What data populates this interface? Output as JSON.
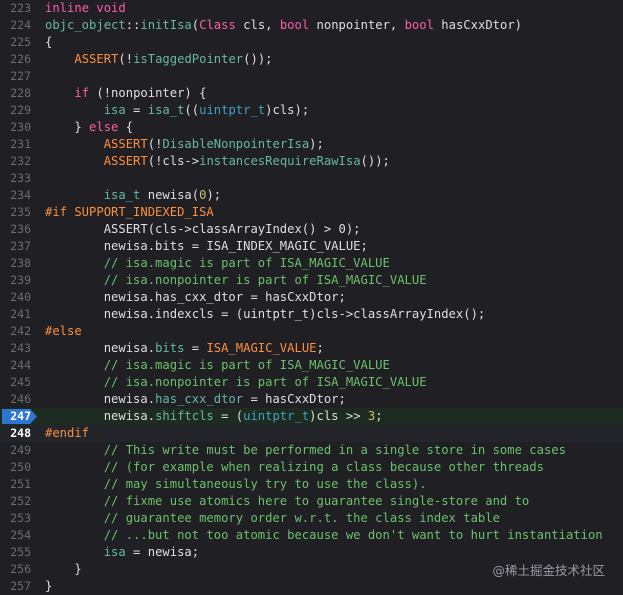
{
  "editor": {
    "lines": [
      {
        "n": "223",
        "code": "inline void",
        "tokens": [
          [
            "kw",
            "inline void"
          ]
        ]
      },
      {
        "n": "224",
        "code": "objc_object::initIsa(Class cls, bool nonpointer, bool hasCxxDtor)",
        "tokens": [
          [
            "fn",
            "objc_object"
          ],
          [
            "",
            "::"
          ],
          [
            "fn",
            "initIsa"
          ],
          [
            "",
            "("
          ],
          [
            "kw",
            "Class"
          ],
          [
            "",
            " cls, "
          ],
          [
            "kw",
            "bool"
          ],
          [
            "",
            " nonpointer, "
          ],
          [
            "kw",
            "bool"
          ],
          [
            "",
            " hasCxxDtor)"
          ]
        ]
      },
      {
        "n": "225",
        "code": "{",
        "tokens": [
          [
            "",
            "{"
          ]
        ]
      },
      {
        "n": "226",
        "code": "    ASSERT(!isTaggedPointer());",
        "tokens": [
          [
            "",
            "    "
          ],
          [
            "mac",
            "ASSERT"
          ],
          [
            "",
            "(!"
          ],
          [
            "fn",
            "isTaggedPointer"
          ],
          [
            "",
            "());"
          ]
        ]
      },
      {
        "n": "227",
        "code": "",
        "tokens": []
      },
      {
        "n": "228",
        "code": "    if (!nonpointer) {",
        "tokens": [
          [
            "",
            "    "
          ],
          [
            "kw",
            "if"
          ],
          [
            "",
            " (!nonpointer) {"
          ]
        ]
      },
      {
        "n": "229",
        "code": "        isa = isa_t((uintptr_t)cls);",
        "tokens": [
          [
            "",
            "        "
          ],
          [
            "fn",
            "isa"
          ],
          [
            "",
            " = "
          ],
          [
            "fn",
            "isa_t"
          ],
          [
            "",
            "(("
          ],
          [
            "ty",
            "uintptr_t"
          ],
          [
            "",
            ")cls);"
          ]
        ]
      },
      {
        "n": "230",
        "code": "    } else {",
        "tokens": [
          [
            "",
            "    } "
          ],
          [
            "kw",
            "else"
          ],
          [
            "",
            " {"
          ]
        ]
      },
      {
        "n": "231",
        "code": "        ASSERT(!DisableNonpointerIsa);",
        "tokens": [
          [
            "",
            "        "
          ],
          [
            "mac",
            "ASSERT"
          ],
          [
            "",
            "(!"
          ],
          [
            "fn",
            "DisableNonpointerIsa"
          ],
          [
            "",
            ");"
          ]
        ]
      },
      {
        "n": "232",
        "code": "        ASSERT(!cls->instancesRequireRawIsa());",
        "tokens": [
          [
            "",
            "        "
          ],
          [
            "mac",
            "ASSERT"
          ],
          [
            "",
            "(!cls->"
          ],
          [
            "fn",
            "instancesRequireRawIsa"
          ],
          [
            "",
            "());"
          ]
        ]
      },
      {
        "n": "233",
        "code": "",
        "tokens": []
      },
      {
        "n": "234",
        "code": "        isa_t newisa(0);",
        "tokens": [
          [
            "",
            "        "
          ],
          [
            "fn",
            "isa_t"
          ],
          [
            "",
            " newisa("
          ],
          [
            "num",
            "0"
          ],
          [
            "",
            ");"
          ]
        ]
      },
      {
        "n": "235",
        "code": "#if SUPPORT_INDEXED_ISA",
        "tokens": [
          [
            "pp",
            "#if SUPPORT_INDEXED_ISA"
          ]
        ]
      },
      {
        "n": "236",
        "code": "        ASSERT(cls->classArrayIndex() > 0);",
        "tokens": [
          [
            "",
            "        ASSERT(cls->classArrayIndex() > 0);"
          ]
        ]
      },
      {
        "n": "237",
        "code": "        newisa.bits = ISA_INDEX_MAGIC_VALUE;",
        "tokens": [
          [
            "",
            "        newisa.bits = ISA_INDEX_MAGIC_VALUE;"
          ]
        ]
      },
      {
        "n": "238",
        "code": "        // isa.magic is part of ISA_MAGIC_VALUE",
        "tokens": [
          [
            "cm",
            "        // isa.magic is part of ISA_MAGIC_VALUE"
          ]
        ]
      },
      {
        "n": "239",
        "code": "        // isa.nonpointer is part of ISA_MAGIC_VALUE",
        "tokens": [
          [
            "cm",
            "        // isa.nonpointer is part of ISA_MAGIC_VALUE"
          ]
        ]
      },
      {
        "n": "240",
        "code": "        newisa.has_cxx_dtor = hasCxxDtor;",
        "tokens": [
          [
            "",
            "        newisa.has_cxx_dtor = hasCxxDtor;"
          ]
        ]
      },
      {
        "n": "241",
        "code": "        newisa.indexcls = (uintptr_t)cls->classArrayIndex();",
        "tokens": [
          [
            "",
            "        newisa.indexcls = (uintptr_t)cls->classArrayIndex();"
          ]
        ]
      },
      {
        "n": "242",
        "code": "#else",
        "tokens": [
          [
            "pp",
            "#else"
          ]
        ]
      },
      {
        "n": "243",
        "code": "        newisa.bits = ISA_MAGIC_VALUE;",
        "tokens": [
          [
            "",
            "        newisa."
          ],
          [
            "fn",
            "bits"
          ],
          [
            "",
            " = "
          ],
          [
            "mac",
            "ISA_MAGIC_VALUE"
          ],
          [
            "",
            ";"
          ]
        ]
      },
      {
        "n": "244",
        "code": "        // isa.magic is part of ISA_MAGIC_VALUE",
        "tokens": [
          [
            "cm",
            "        // isa.magic is part of ISA_MAGIC_VALUE"
          ]
        ]
      },
      {
        "n": "245",
        "code": "        // isa.nonpointer is part of ISA_MAGIC_VALUE",
        "tokens": [
          [
            "cm",
            "        // isa.nonpointer is part of ISA_MAGIC_VALUE"
          ]
        ]
      },
      {
        "n": "246",
        "code": "        newisa.has_cxx_dtor = hasCxxDtor;",
        "tokens": [
          [
            "",
            "        newisa."
          ],
          [
            "fn",
            "has_cxx_dtor"
          ],
          [
            "",
            " = hasCxxDtor;"
          ]
        ]
      },
      {
        "n": "247",
        "code": "        newisa.shiftcls = (uintptr_t)cls >> 3;",
        "tokens": [
          [
            "",
            "        newisa."
          ],
          [
            "fn",
            "shiftcls"
          ],
          [
            "",
            " = ("
          ],
          [
            "ty",
            "uintptr_t"
          ],
          [
            "",
            ")cls >> "
          ],
          [
            "num",
            "3"
          ],
          [
            "",
            ";"
          ]
        ]
      },
      {
        "n": "248",
        "code": "#endif",
        "tokens": [
          [
            "pp",
            "#endif"
          ]
        ]
      },
      {
        "n": "249",
        "code": "        // This write must be performed in a single store in some cases",
        "tokens": [
          [
            "cm",
            "        // This write must be performed in a single store in some cases"
          ]
        ]
      },
      {
        "n": "250",
        "code": "        // (for example when realizing a class because other threads",
        "tokens": [
          [
            "cm",
            "        // (for example when realizing a class because other threads"
          ]
        ]
      },
      {
        "n": "251",
        "code": "        // may simultaneously try to use the class).",
        "tokens": [
          [
            "cm",
            "        // may simultaneously try to use the class)."
          ]
        ]
      },
      {
        "n": "252",
        "code": "        // fixme use atomics here to guarantee single-store and to",
        "tokens": [
          [
            "cm",
            "        // fixme use atomics here to guarantee single-store and to"
          ]
        ]
      },
      {
        "n": "253",
        "code": "        // guarantee memory order w.r.t. the class index table",
        "tokens": [
          [
            "cm",
            "        // guarantee memory order w.r.t. the class index table"
          ]
        ]
      },
      {
        "n": "254",
        "code": "        // ...but not too atomic because we don't want to hurt instantiation",
        "tokens": [
          [
            "cm",
            "        // ...but not too atomic because we don't want to hurt instantiation"
          ]
        ]
      },
      {
        "n": "255",
        "code": "        isa = newisa;",
        "tokens": [
          [
            "",
            "        "
          ],
          [
            "fn",
            "isa"
          ],
          [
            "",
            " = newisa;"
          ]
        ]
      },
      {
        "n": "256",
        "code": "    }",
        "tokens": [
          [
            "",
            "    }"
          ]
        ]
      },
      {
        "n": "257",
        "code": "}",
        "tokens": [
          [
            "",
            "}"
          ]
        ]
      }
    ],
    "breakpoint_line": "247",
    "current_line": "248",
    "colors": {
      "background": "#1f1f24",
      "breakpoint": "#2f76d3",
      "keyword": "#fc5fa3",
      "comment": "#6bc16b",
      "preprocessor": "#fd8f3f",
      "type": "#41a1c0"
    }
  },
  "watermark": {
    "text": "@稀土掘金技术社区"
  }
}
